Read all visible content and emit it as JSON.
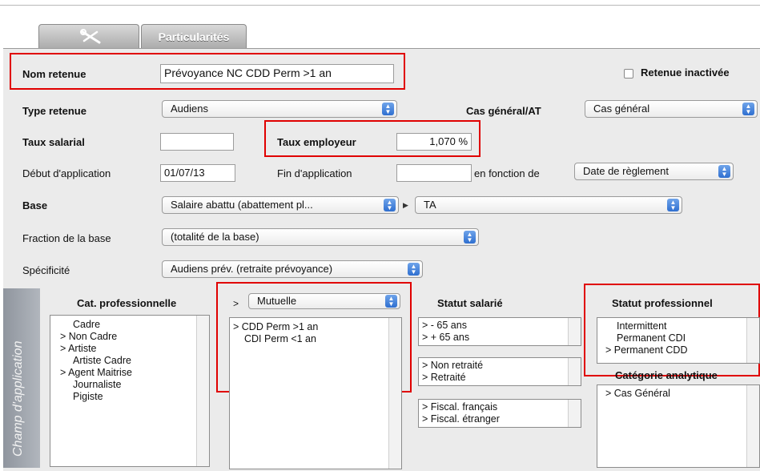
{
  "tabs": [
    {
      "icon": "tools-icon"
    },
    {
      "label": "Particularités"
    }
  ],
  "form": {
    "nom_label": "Nom retenue",
    "nom_value": "Prévoyance NC CDD Perm >1 an",
    "inactivee_label": "Retenue inactivée",
    "type_label": "Type retenue",
    "type_value": "Audiens",
    "cas_label": "Cas général/AT",
    "cas_value": "Cas général",
    "taux_sal_label": "Taux salarial",
    "taux_sal_value": "",
    "taux_emp_label": "Taux employeur",
    "taux_emp_value": "1,070 %",
    "debut_label": "Début d'application",
    "debut_value": "01/07/13",
    "fin_label": "Fin d'application",
    "fin_value": "",
    "fonction_label": "en fonction de",
    "fonction_value": "Date de règlement",
    "base_label": "Base",
    "base_value": "Salaire abattu (abattement pl...",
    "base_tranche": "TA",
    "fraction_label": "Fraction de la base",
    "fraction_value": "(totalité de la base)",
    "specificite_label": "Spécificité",
    "specificite_value": "Audiens prév. (retraite prévoyance)"
  },
  "champ": {
    "vertical_label": "Champ d'application",
    "cat_pro_header": "Cat. professionnelle",
    "cat_pro_items": [
      "Cadre",
      "> Non Cadre",
      "> Artiste",
      "Artiste Cadre",
      "> Agent Maitrise",
      "Journaliste",
      "Pigiste"
    ],
    "mutuelle_prefix": ">",
    "mutuelle_value": "Mutuelle",
    "mutuelle_items": [
      "> CDD Perm >1 an",
      "CDI Perm <1 an"
    ],
    "statut_sal_header": "Statut salarié",
    "age_items": [
      ">  - 65 ans",
      ">  + 65 ans"
    ],
    "retraite_items": [
      "> Non retraité",
      "> Retraité"
    ],
    "fiscal_items": [
      "> Fiscal. français",
      "> Fiscal. étranger"
    ],
    "statut_pro_header": "Statut professionnel",
    "statut_pro_items": [
      "Intermittent",
      "Permanent CDI",
      "> Permanent CDD"
    ],
    "categorie_header": "Catégorie analytique",
    "categorie_items": [
      "> Cas Général"
    ]
  },
  "colors": {
    "highlight": "#e00000",
    "select_arrows": "#2f6fd0"
  }
}
